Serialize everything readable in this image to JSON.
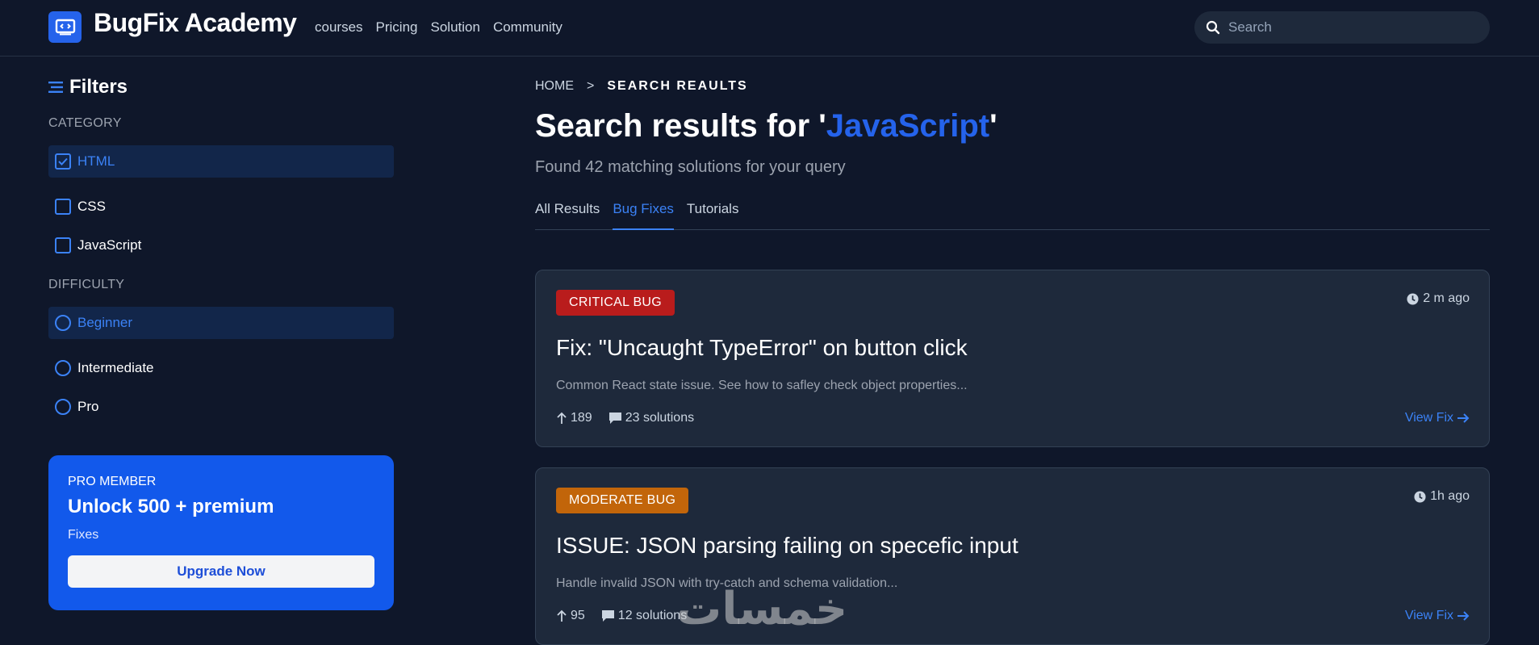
{
  "header": {
    "brand": "BugFix Academy",
    "nav": [
      "courses",
      "Pricing",
      "Solution",
      "Community"
    ],
    "search_placeholder": "Search"
  },
  "sidebar": {
    "title": "Filters",
    "category_label": "CATEGORY",
    "categories": [
      {
        "label": "HTML",
        "checked": true
      },
      {
        "label": "CSS",
        "checked": false
      },
      {
        "label": "JavaScript",
        "checked": false
      }
    ],
    "difficulty_label": "DIFFICULTY",
    "difficulties": [
      {
        "label": "Beginner",
        "selected": true
      },
      {
        "label": "Intermediate",
        "selected": false
      },
      {
        "label": "Pro",
        "selected": false
      }
    ],
    "promo": {
      "tag": "PRO MEMBER",
      "headline": "Unlock 500 + premium",
      "sub": "Fixes",
      "button": "Upgrade Now"
    }
  },
  "main": {
    "breadcrumb": {
      "home": "HOME",
      "separator": ">",
      "current": "SEARCH REAULTS"
    },
    "heading_prefix": "Search results for '",
    "query": "JavaScript",
    "heading_suffix": "'",
    "found_text": "Found 42 matching solutions for your query",
    "tabs": [
      {
        "label": "All Results",
        "active": false
      },
      {
        "label": "Bug Fixes",
        "active": true
      },
      {
        "label": "Tutorials",
        "active": false
      }
    ],
    "cards": [
      {
        "badge": "CRITICAL BUG",
        "badge_color": "#b91c1c",
        "time": "2 m ago",
        "title": "Fix: \"Uncaught TypeError\" on button click",
        "description": "Common React state issue. See how to safley check object properties...",
        "upvotes": "189",
        "solutions": "23 solutions",
        "action": "View Fix"
      },
      {
        "badge": "MODERATE BUG",
        "badge_color": "#c2650a",
        "time": "1h ago",
        "title": "ISSUE: JSON parsing failing on specefic input",
        "description": "Handle invalid JSON with try-catch and schema validation...",
        "upvotes": "95",
        "solutions": "12 solutions",
        "action": "View Fix"
      }
    ]
  },
  "watermark": "خمسات",
  "colors": {
    "accent": "#2563eb",
    "background": "#0f172a",
    "card": "#1e293b"
  }
}
